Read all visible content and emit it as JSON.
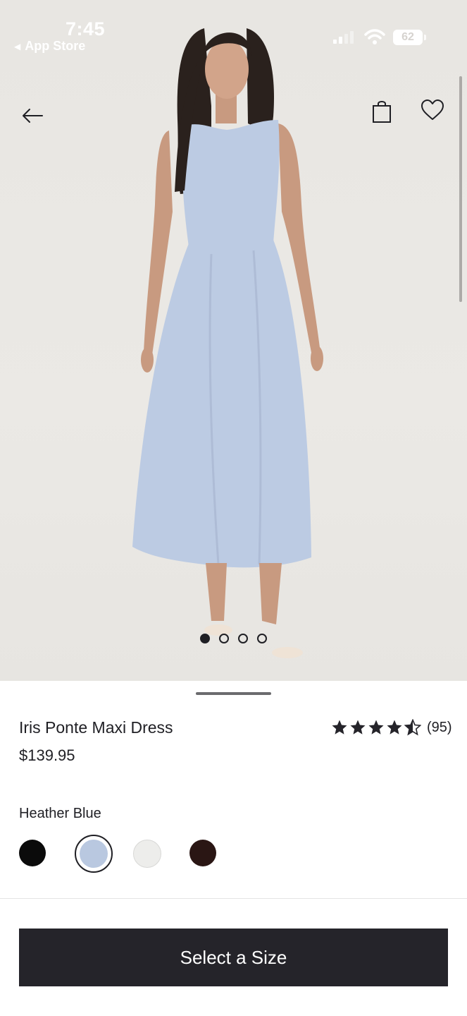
{
  "status_bar": {
    "time": "7:45",
    "back_app": "App Store",
    "battery": "62"
  },
  "nav": {
    "back_icon": "arrow-left-icon",
    "bag_icon": "shopping-bag-icon",
    "wishlist_icon": "heart-icon"
  },
  "gallery": {
    "image_count": 4,
    "active_index": 0
  },
  "product": {
    "name": "Iris Ponte Maxi Dress",
    "price": "$139.95",
    "rating": 4.5,
    "review_count": "(95)"
  },
  "colors": {
    "selected_label": "Heather Blue",
    "swatches": [
      {
        "hex": "#0b0b0b",
        "selected": false
      },
      {
        "hex": "#b9c8e0",
        "selected": true
      },
      {
        "hex": "#ededeb",
        "selected": false
      },
      {
        "hex": "#2a1614",
        "selected": false
      }
    ]
  },
  "cta": {
    "label": "Select a Size"
  },
  "theme": {
    "primary": "#25242a",
    "background": "#ffffff",
    "dress": "#bccbe3"
  }
}
